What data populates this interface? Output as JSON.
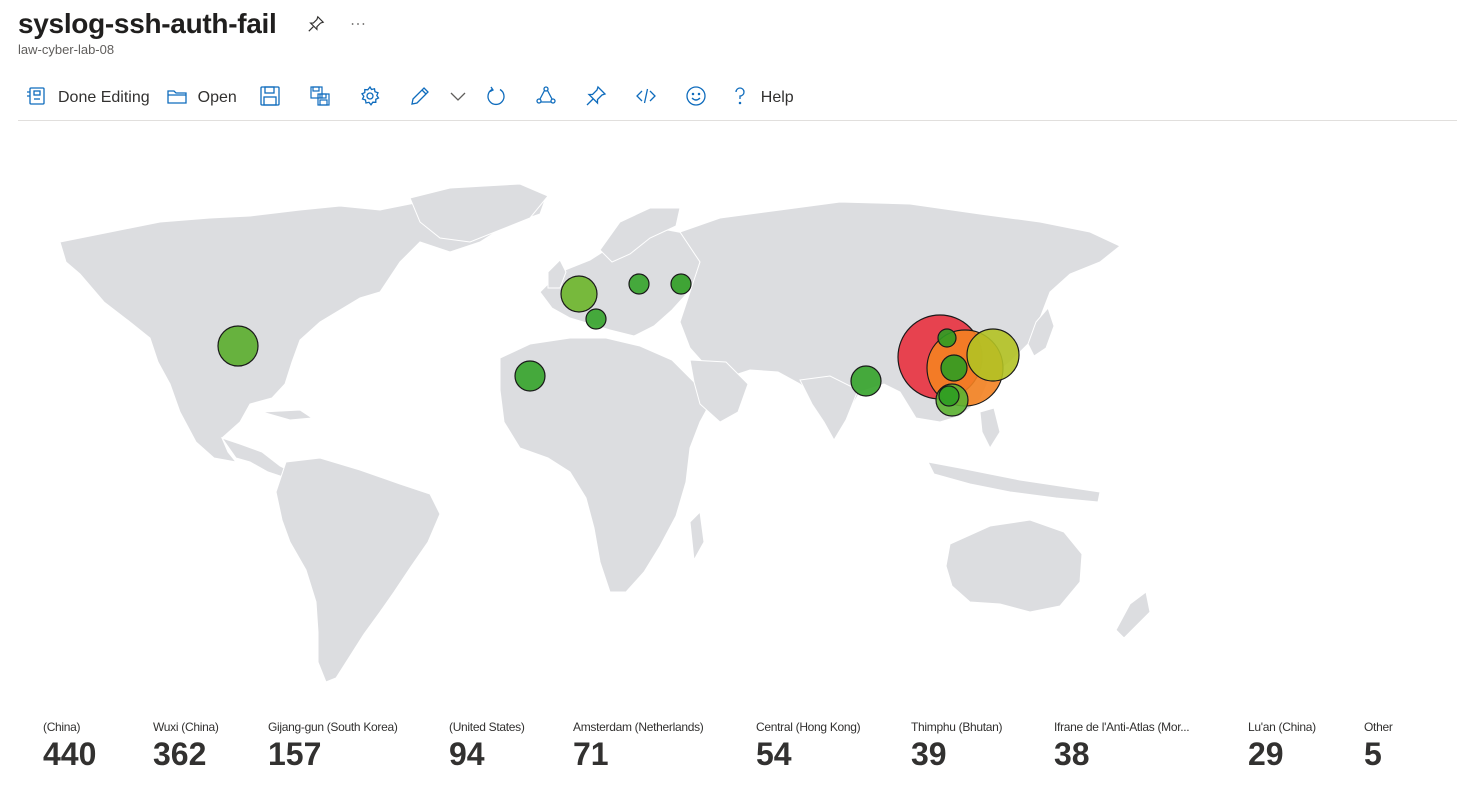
{
  "header": {
    "title": "syslog-ssh-auth-fail",
    "subtitle": "law-cyber-lab-08",
    "pin_icon": "pin-icon",
    "more_icon": "ellipsis-icon"
  },
  "toolbar": {
    "done_editing_label": "Done Editing",
    "open_label": "Open",
    "help_label": "Help",
    "icons": [
      "done-editing-icon",
      "folder-icon",
      "save-icon",
      "save-as-icon",
      "settings-icon",
      "edit-icon",
      "chevron-down-icon",
      "refresh-icon",
      "share-icon",
      "pin-icon",
      "code-icon",
      "smiley-icon",
      "help-icon"
    ]
  },
  "map": {
    "land_color": "#dcdde0",
    "bubbles": [
      {
        "name": "(China)",
        "color": "#e8313f"
      },
      {
        "name": "Wuxi (China)",
        "color": "#f48221"
      },
      {
        "name": "Gijang-gun (South Korea)",
        "color": "#b3c224"
      },
      {
        "name": "(United States)",
        "color": "#5aad2c"
      },
      {
        "name": "Amsterdam (Netherlands)",
        "color": "#6cb52a"
      },
      {
        "name": "Central (Hong Kong)",
        "color": "#5cb332"
      },
      {
        "name": "Thimphu (Bhutan)",
        "color": "#34a32a"
      },
      {
        "name": "Ifrane de l'Anti-Atlas (Morocco)",
        "color": "#34a32a"
      },
      {
        "name": "Lu'an (China)",
        "color": "#2e9d22"
      },
      {
        "name": "Other",
        "color": "#2e9d22"
      }
    ]
  },
  "legend": [
    {
      "label": "(China)",
      "value": "440"
    },
    {
      "label": "Wuxi (China)",
      "value": "362"
    },
    {
      "label": "Gijang-gun (South Korea)",
      "value": "157"
    },
    {
      "label": "(United States)",
      "value": "94"
    },
    {
      "label": "Amsterdam (Netherlands)",
      "value": "71"
    },
    {
      "label": "Central (Hong Kong)",
      "value": "54"
    },
    {
      "label": "Thimphu (Bhutan)",
      "value": "39"
    },
    {
      "label": "Ifrane de l'Anti-Atlas (Mor...",
      "value": "38"
    },
    {
      "label": "Lu'an (China)",
      "value": "29"
    },
    {
      "label": "Other",
      "value": "5"
    }
  ]
}
